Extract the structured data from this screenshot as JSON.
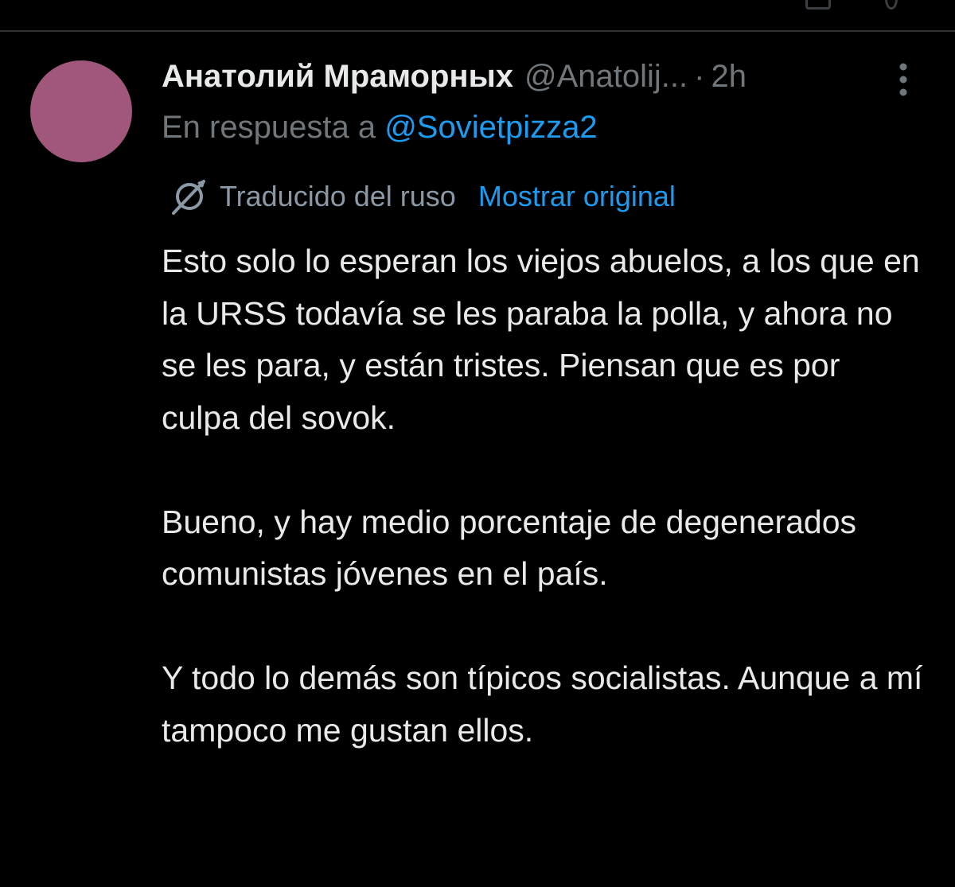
{
  "tweet": {
    "display_name": "Анатолий Мраморных",
    "handle": "@Anatolij...",
    "separator": "·",
    "time_ago": "2h",
    "reply_prefix": "En respuesta a",
    "reply_to": "@Sovietpizza2",
    "translated_label": "Traducido del ruso",
    "show_original_label": "Mostrar original",
    "paragraphs": [
      "Esto solo lo esperan los viejos abuelos, a los que en la URSS todavía se les paraba la polla, y ahora no se les para, y están tristes. Piensan que es por culpa del sovok.",
      "Bueno, y hay medio porcentaje de degenerados comunistas jóvenes en el país.",
      "Y todo lo demás son típicos socialistas. Aunque a mí tampoco me gustan ellos."
    ]
  },
  "icons": {
    "more": "more-vertical-icon",
    "translate": "translate-icon"
  },
  "colors": {
    "background": "#000000",
    "primary_text": "#e7e9ea",
    "secondary_text": "#71767b",
    "link": "#1d9bf0",
    "avatar": "#a0577b",
    "divider": "#2f3336"
  }
}
